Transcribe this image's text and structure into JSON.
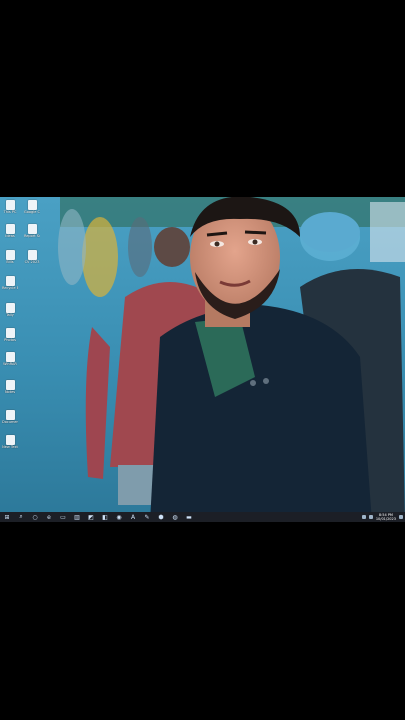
{
  "desktop": {
    "icons": [
      {
        "label": "This PC",
        "col": 0
      },
      {
        "label": "Google Chrome",
        "col": 1
      },
      {
        "label": "Ideas",
        "col": 0
      },
      {
        "label": "Report Summary",
        "col": 1
      },
      {
        "label": "Bills",
        "col": 0
      },
      {
        "label": "CV 2023",
        "col": 1
      },
      {
        "label": "Recycle Bin",
        "col": 0
      },
      {
        "label": "Tally",
        "col": 0
      },
      {
        "label": "Photos",
        "col": 0
      },
      {
        "label": "WinRAR",
        "col": 0
      },
      {
        "label": "Notes",
        "col": 0
      },
      {
        "label": "Document",
        "col": 0
      },
      {
        "label": "New Text",
        "col": 0
      }
    ]
  },
  "taskbar": {
    "start": "⊞",
    "search": "⌕",
    "taskview": "○",
    "pinned": [
      "e",
      "▭",
      "▥",
      "◩",
      "◧",
      "◉",
      "A",
      "✎",
      "⬢",
      "◍",
      "▬"
    ],
    "time": "8:54 PM",
    "date": "10/01/2023"
  },
  "colors": {
    "taskbar": "#1c1f26",
    "accent": "#2a6f93"
  }
}
